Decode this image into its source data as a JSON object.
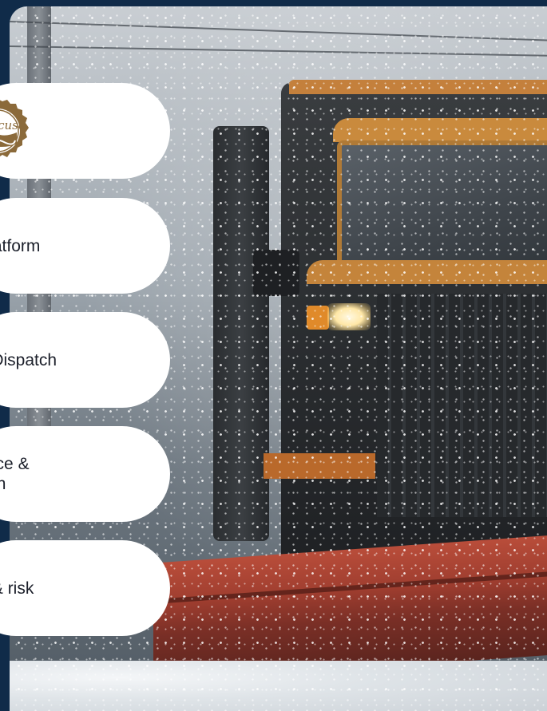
{
  "logo": {
    "text": "Syracuse",
    "icon": "syracuse-seal-icon",
    "color": "#8b6a3a"
  },
  "menu": {
    "items": [
      {
        "label": "n platform"
      },
      {
        "label": "g & Dispatch"
      },
      {
        "line1": "tenance &",
        "line2": "lization"
      },
      {
        "label": "ety & risk"
      }
    ]
  },
  "colors": {
    "frame": "#102b49",
    "pill": "#ffffff",
    "text": "#1b1f2a"
  }
}
